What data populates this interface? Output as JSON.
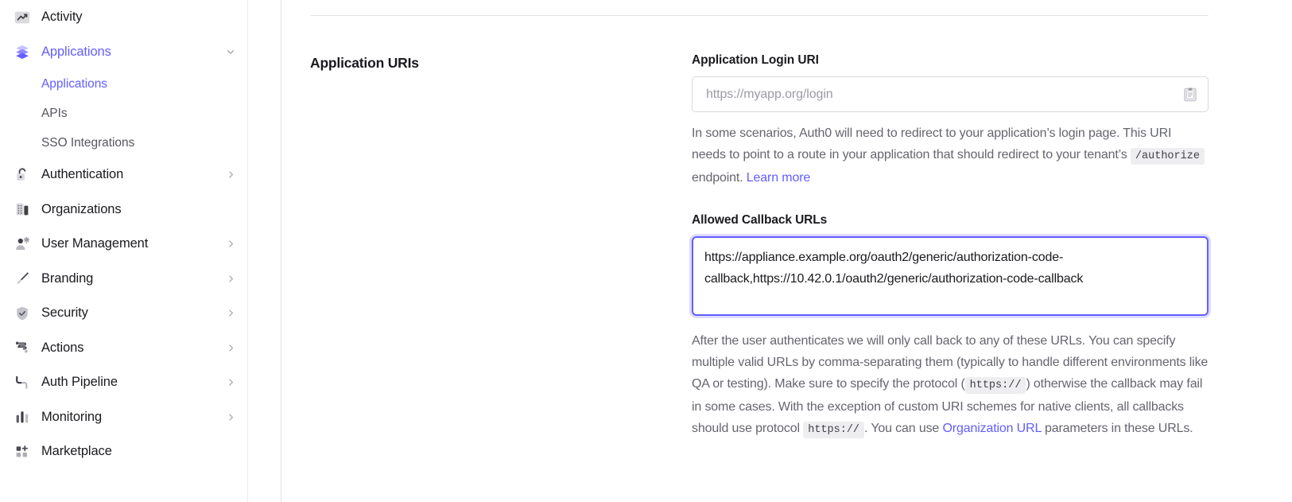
{
  "sidebar": {
    "items": [
      {
        "label": "Activity",
        "icon": "activity-chart-icon",
        "expandable": false,
        "active": false
      },
      {
        "label": "Applications",
        "icon": "layers-icon",
        "expandable": true,
        "expanded": true,
        "active": true
      },
      {
        "label": "Authentication",
        "icon": "unlock-icon",
        "expandable": true,
        "active": false
      },
      {
        "label": "Organizations",
        "icon": "building-icon",
        "expandable": false,
        "active": false
      },
      {
        "label": "User Management",
        "icon": "user-gear-icon",
        "expandable": true,
        "active": false
      },
      {
        "label": "Branding",
        "icon": "paintbrush-icon",
        "expandable": true,
        "active": false
      },
      {
        "label": "Security",
        "icon": "shield-check-icon",
        "expandable": true,
        "active": false
      },
      {
        "label": "Actions",
        "icon": "flow-icon",
        "expandable": true,
        "active": false
      },
      {
        "label": "Auth Pipeline",
        "icon": "pipeline-icon",
        "expandable": true,
        "active": false
      },
      {
        "label": "Monitoring",
        "icon": "bar-chart-icon",
        "expandable": true,
        "active": false
      },
      {
        "label": "Marketplace",
        "icon": "grid-plus-icon",
        "expandable": false,
        "active": false
      }
    ],
    "subnav": [
      {
        "label": "Applications",
        "active": true
      },
      {
        "label": "APIs",
        "active": false
      },
      {
        "label": "SSO Integrations",
        "active": false
      }
    ]
  },
  "main": {
    "section_title": "Application URIs",
    "login_uri": {
      "label": "Application Login URI",
      "value": "",
      "placeholder": "https://myapp.org/login",
      "adornment_icon": "paste-clipboard-icon",
      "helper": {
        "part1": "In some scenarios, Auth0 will need to redirect to your application’s login page. This URI needs to point to a route in your application that should redirect to your tenant’s ",
        "code1": "/authorize",
        "part2": " endpoint. ",
        "link_text": "Learn more"
      }
    },
    "callback_urls": {
      "label": "Allowed Callback URLs",
      "value": "https://appliance.example.org/oauth2/generic/authorization-code-callback,https://10.42.0.1/oauth2/generic/authorization-code-callback",
      "focused": true,
      "helper": {
        "part1": "After the user authenticates we will only call back to any of these URLs. You can specify multiple valid URLs by comma-separating them (typically to handle different environments like QA or testing). Make sure to specify the protocol (",
        "code1": "https://",
        "part2": ") otherwise the callback may fail in some cases. With the exception of custom URI schemes for native clients, all callbacks should use protocol ",
        "code2": "https://",
        "part3": ". You can use ",
        "link_text": "Organization URL",
        "part4": " parameters in these URLs."
      }
    }
  },
  "colors": {
    "accent": "#635dff",
    "text_primary": "#1a1a1f",
    "text_secondary": "#65656f",
    "border": "#d8d8de",
    "code_bg": "#eeeef1"
  }
}
